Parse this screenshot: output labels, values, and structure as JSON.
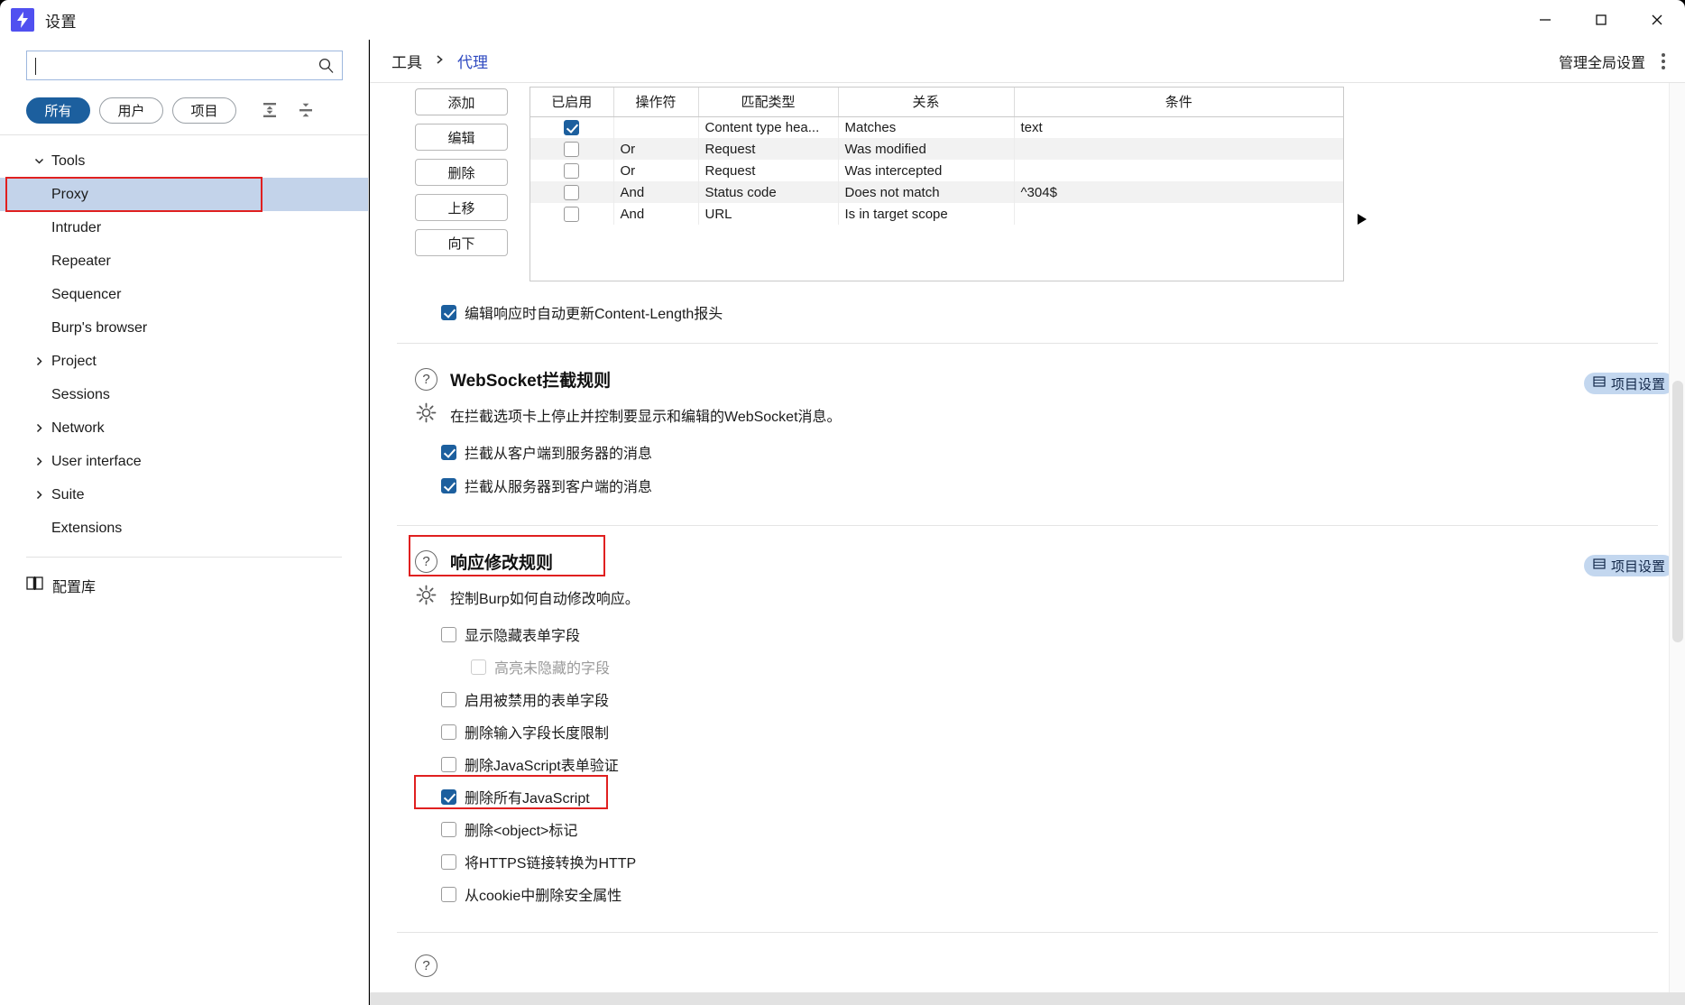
{
  "window": {
    "title": "设置",
    "logo_icon": "burp-lightning-icon",
    "minimize_icon": "minimize-icon",
    "maximize_icon": "maximize-icon",
    "close_icon": "close-icon"
  },
  "sidebar": {
    "search": {
      "value": "",
      "placeholder": "",
      "icon": "search-icon"
    },
    "filters": [
      {
        "label": "所有",
        "active": true
      },
      {
        "label": "用户",
        "active": false
      },
      {
        "label": "项目",
        "active": false
      }
    ],
    "tree_tools": [
      {
        "name": "expand-all-icon"
      },
      {
        "name": "collapse-all-icon"
      }
    ],
    "tree": [
      {
        "label": "Tools",
        "expanded": true,
        "arrow": "chevron-down",
        "level": 0
      },
      {
        "label": "Proxy",
        "level": 1,
        "selected": true,
        "highlighted": true
      },
      {
        "label": "Intruder",
        "level": 1
      },
      {
        "label": "Repeater",
        "level": 1
      },
      {
        "label": "Sequencer",
        "level": 1
      },
      {
        "label": "Burp's browser",
        "level": 1
      },
      {
        "label": "Project",
        "expanded": false,
        "arrow": "chevron-right",
        "level": 0
      },
      {
        "label": "Sessions",
        "level": 0,
        "noarrow": true
      },
      {
        "label": "Network",
        "expanded": false,
        "arrow": "chevron-right",
        "level": 0
      },
      {
        "label": "User interface",
        "expanded": false,
        "arrow": "chevron-right",
        "level": 0
      },
      {
        "label": "Suite",
        "expanded": false,
        "arrow": "chevron-right",
        "level": 0
      },
      {
        "label": "Extensions",
        "level": 0,
        "noarrow": true
      }
    ],
    "library": {
      "label": "配置库",
      "icon": "book-icon"
    }
  },
  "header": {
    "breadcrumb": [
      {
        "label": "工具",
        "link": false
      },
      {
        "label": "代理",
        "link": true
      }
    ],
    "separator": "›",
    "global_settings_label": "管理全局设置",
    "kebab_icon": "more-vertical-icon"
  },
  "rules_panel": {
    "buttons": [
      "添加",
      "编辑",
      "删除",
      "上移",
      "向下"
    ],
    "table": {
      "columns": [
        "已启用",
        "操作符",
        "匹配类型",
        "关系",
        "条件"
      ],
      "rows": [
        {
          "enabled": true,
          "op": "",
          "type": "Content type hea...",
          "rel": "Matches",
          "cond": "text"
        },
        {
          "enabled": false,
          "op": "Or",
          "type": "Request",
          "rel": "Was modified",
          "cond": ""
        },
        {
          "enabled": false,
          "op": "Or",
          "type": "Request",
          "rel": "Was intercepted",
          "cond": ""
        },
        {
          "enabled": false,
          "op": "And",
          "type": "Status code",
          "rel": "Does not match",
          "cond": "^304$"
        },
        {
          "enabled": false,
          "op": "And",
          "type": "URL",
          "rel": "Is in target scope",
          "cond": ""
        }
      ]
    },
    "expander_icon": "triangle-right-icon",
    "auto_update_checkbox": {
      "label": "编辑响应时自动更新Content-Length报头",
      "checked": true
    }
  },
  "websocket_section": {
    "help_icon": "question-circle-icon",
    "gear_icon": "gear-icon",
    "title": "WebSocket拦截规则",
    "description": "在拦截选项卡上停止并控制要显示和编辑的WebSocket消息。",
    "badge": "项目设置",
    "options": [
      {
        "label": "拦截从客户端到服务器的消息",
        "checked": true
      },
      {
        "label": "拦截从服务器到客户端的消息",
        "checked": true
      }
    ]
  },
  "response_section": {
    "help_icon": "question-circle-icon",
    "gear_icon": "gear-icon",
    "title": "响应修改规则",
    "title_highlighted": true,
    "description": "控制Burp如何自动修改响应。",
    "badge": "项目设置",
    "options": [
      {
        "label": "显示隐藏表单字段",
        "checked": false,
        "indent": false,
        "disabled": false
      },
      {
        "label": "高亮未隐藏的字段",
        "checked": false,
        "indent": true,
        "disabled": true
      },
      {
        "label": "启用被禁用的表单字段",
        "checked": false,
        "indent": false,
        "disabled": false
      },
      {
        "label": "删除输入字段长度限制",
        "checked": false,
        "indent": false,
        "disabled": false
      },
      {
        "label": "删除JavaScript表单验证",
        "checked": false,
        "indent": false,
        "disabled": false
      },
      {
        "label": "删除所有JavaScript",
        "checked": true,
        "indent": false,
        "disabled": false,
        "highlighted": true
      },
      {
        "label": "删除<object>标记",
        "checked": false,
        "indent": false,
        "disabled": false
      },
      {
        "label": "将HTTPS链接转换为HTTP",
        "checked": false,
        "indent": false,
        "disabled": false
      },
      {
        "label": "从cookie中删除安全属性",
        "checked": false,
        "indent": false,
        "disabled": false
      }
    ]
  },
  "colors": {
    "accent": "#1c5f9e",
    "selection": "#c3d3ea",
    "highlight_box": "#e02020",
    "link": "#2e49c0",
    "logo": "#5050f0",
    "badge_bg": "#c3d7ef"
  }
}
